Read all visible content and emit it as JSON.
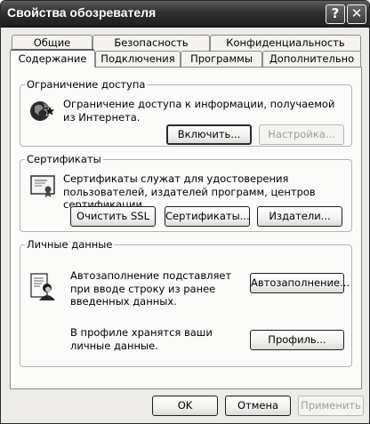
{
  "window": {
    "title": "Свойства обозревателя"
  },
  "titlebar": {
    "help_glyph": "?",
    "close_glyph": "✕"
  },
  "tabs": {
    "row1": [
      "Общие",
      "Безопасность",
      "Конфиденциальность"
    ],
    "row2": [
      "Содержание",
      "Подключения",
      "Программы",
      "Дополнительно"
    ],
    "active": "Содержание"
  },
  "content_advisor": {
    "title": "Ограничение доступа",
    "description": "Ограничение доступа к информации, получаемой из Интернета.",
    "enable_button": "Включить...",
    "settings_button": "Настройка..."
  },
  "certificates": {
    "title": "Сертификаты",
    "description": "Сертификаты служат для удостоверения пользователей, издателей программ, центров сертификации.",
    "clear_ssl_button": "Очистить SSL",
    "certificates_button": "Сертификаты...",
    "publishers_button": "Издатели..."
  },
  "personal_info": {
    "title": "Личные данные",
    "autocomplete_description": "Автозаполнение подставляет при вводе строку из ранее введенных данных.",
    "autocomplete_button": "Автозаполнение...",
    "profile_description": "В профиле хранятся ваши личные данные.",
    "profile_button": "Профиль..."
  },
  "footer": {
    "ok_button": "OK",
    "cancel_button": "Отмена",
    "apply_button": "Применить"
  }
}
